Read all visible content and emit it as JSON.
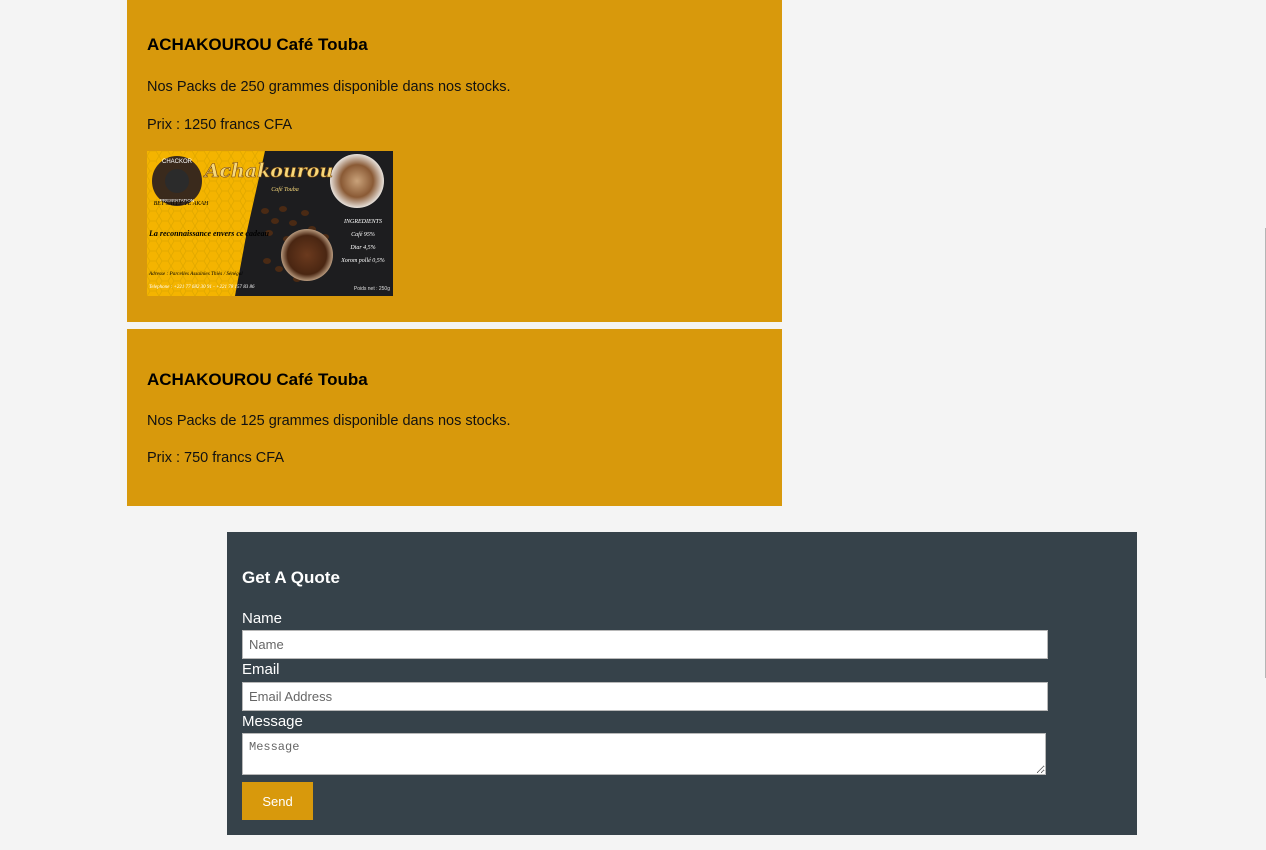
{
  "products": [
    {
      "title": "ACHAKOUROU Café Touba",
      "description": "Nos Packs de 250 grammes disponible dans nos stocks.",
      "price": "Prix : 1250 francs CFA",
      "image": {
        "brand_script": "Achakourou",
        "brand_sub": "Café Touba",
        "badge_top": "CHACKOR",
        "badge_bottom": "PRESENTATION",
        "slogan": "BEY SALLE TE AKAH",
        "tagline": "La reconnaissance envers ce cadeau",
        "ingredients_title": "INGREDIENTS",
        "ingredient_1": "Café 95%",
        "ingredient_2": "Diar 4,5%",
        "ingredient_3": "Xorom pollé 0,5%",
        "address": "Adresse : Parcelles Assainies Thiès / Sénégal",
        "phone": "Telephone : +221 77 682 30 91 - +221 78 157 83 86",
        "net_weight": "Poids net : 250g"
      }
    },
    {
      "title": "ACHAKOUROU Café Touba",
      "description": "Nos Packs de 125 grammes disponible dans nos stocks.",
      "price": "Prix : 750 francs CFA"
    }
  ],
  "quote_form": {
    "title": "Get A Quote",
    "name_label": "Name",
    "name_placeholder": "Name",
    "email_label": "Email",
    "email_placeholder": "Email Address",
    "message_label": "Message",
    "message_placeholder": "Message",
    "send_label": "Send"
  },
  "colors": {
    "card_background": "#d8990c",
    "form_background": "#36424a",
    "page_background": "#f4f4f4",
    "button_background": "#d8990c"
  }
}
